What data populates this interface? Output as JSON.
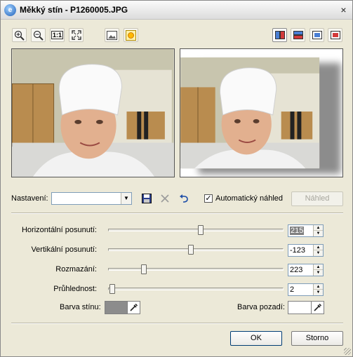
{
  "window": {
    "title": "Měkký stín - P1260005.JPG",
    "close_glyph": "×"
  },
  "toolbar": {
    "left": [
      {
        "name": "zoom-in-icon",
        "title": "zoom in"
      },
      {
        "name": "zoom-out-icon",
        "title": "zoom out"
      },
      {
        "name": "actual-size-icon",
        "label": "1:1"
      },
      {
        "name": "fit-to-window-icon",
        "title": "fit"
      },
      {
        "name": "image-icon",
        "title": "image"
      },
      {
        "name": "sun-icon",
        "title": "sun"
      }
    ],
    "right": [
      {
        "name": "split-vertical-icon",
        "pressed": true
      },
      {
        "name": "split-horizontal-icon",
        "pressed": false
      },
      {
        "name": "single-preview-icon",
        "pressed": false
      },
      {
        "name": "original-only-icon",
        "pressed": false
      }
    ]
  },
  "settings": {
    "label": "Nastavení:",
    "preset_value": "",
    "auto_preview_label": "Automatický náhled",
    "auto_preview_checked": true,
    "preview_button": "Náhled",
    "preview_enabled": false
  },
  "sliders": [
    {
      "label": "Horizontální posunutí:",
      "value": "215",
      "selected": true,
      "level": 0.53
    },
    {
      "label": "Vertikální posunutí:",
      "value": "-123",
      "selected": false,
      "level": 0.47
    },
    {
      "label": "Rozmazání:",
      "value": "223",
      "selected": false,
      "level": 0.2
    },
    {
      "label": "Průhlednost:",
      "value": "2",
      "selected": false,
      "level": 0.02
    }
  ],
  "colors": {
    "shadow_label": "Barva stínu:",
    "shadow_color": "#8c8c8c",
    "background_label": "Barva pozadí:",
    "background_color": "#ffffff"
  },
  "buttons": {
    "ok": "OK",
    "cancel": "Storno"
  },
  "accent": {
    "dialog_bg": "#ece9d8",
    "focus_border": "#003c74"
  }
}
